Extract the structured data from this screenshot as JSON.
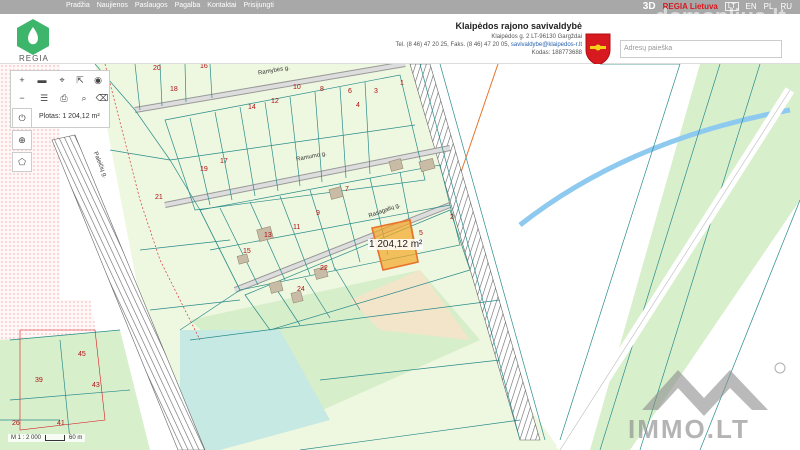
{
  "topnav": {
    "menu": [
      "Pradžia",
      "Naujienos",
      "Paslaugos",
      "Pagalba",
      "Kontaktai",
      "Prisijungti"
    ],
    "view3d": "3D",
    "regia_link": "REGIA Lietuva",
    "languages": [
      "LT",
      "EN",
      "PL",
      "RU"
    ]
  },
  "header": {
    "logo_text": "REGIA",
    "municipality_name": "Klaipėdos rajono savivaldybė",
    "address": "Klaipėdos g. 2 LT-96130 Gargždai",
    "phone_fax": "Tel. (8 46) 47 20 25, Faks. (8 46) 47 20 05,",
    "email": "savivaldybe@klaipedos-r.lt",
    "code": "Kodas: 188773688",
    "search_placeholder": "Adresų paieška"
  },
  "tools": {
    "area_label": "Plotas: 1 204,12 m²"
  },
  "map": {
    "streets": [
      "Ramybės g.",
      "Ramumo g.",
      "Rasagalių g.",
      "Paleičių g."
    ],
    "selected_area": "1 204,12 m²",
    "parcel_numbers": [
      {
        "n": "20"
      },
      {
        "n": "16"
      },
      {
        "n": "18"
      },
      {
        "n": "14"
      },
      {
        "n": "12"
      },
      {
        "n": "10"
      },
      {
        "n": "8"
      },
      {
        "n": "6"
      },
      {
        "n": "4"
      },
      {
        "n": "3"
      },
      {
        "n": "1"
      },
      {
        "n": "2"
      },
      {
        "n": "19"
      },
      {
        "n": "17"
      },
      {
        "n": "15"
      },
      {
        "n": "13"
      },
      {
        "n": "11"
      },
      {
        "n": "9"
      },
      {
        "n": "7"
      },
      {
        "n": "5"
      },
      {
        "n": "21"
      },
      {
        "n": "45"
      },
      {
        "n": "43"
      },
      {
        "n": "39"
      },
      {
        "n": "41"
      },
      {
        "n": "26"
      },
      {
        "n": "24"
      },
      {
        "n": "22"
      }
    ],
    "scale_text": "M 1 : 2 000",
    "scale_dist": "60 m"
  },
  "watermarks": {
    "top": "domoplius.lt",
    "bottom": "IMMO.LT"
  },
  "colors": {
    "topnav": "#a8a8a8",
    "parcel_line": "#2a8c8c",
    "parcel_fill": "#e9f5d9",
    "highlight": "#f5a623",
    "water": "#8ec9ef",
    "railway": "#555555",
    "road_orange": "#e8732c"
  }
}
